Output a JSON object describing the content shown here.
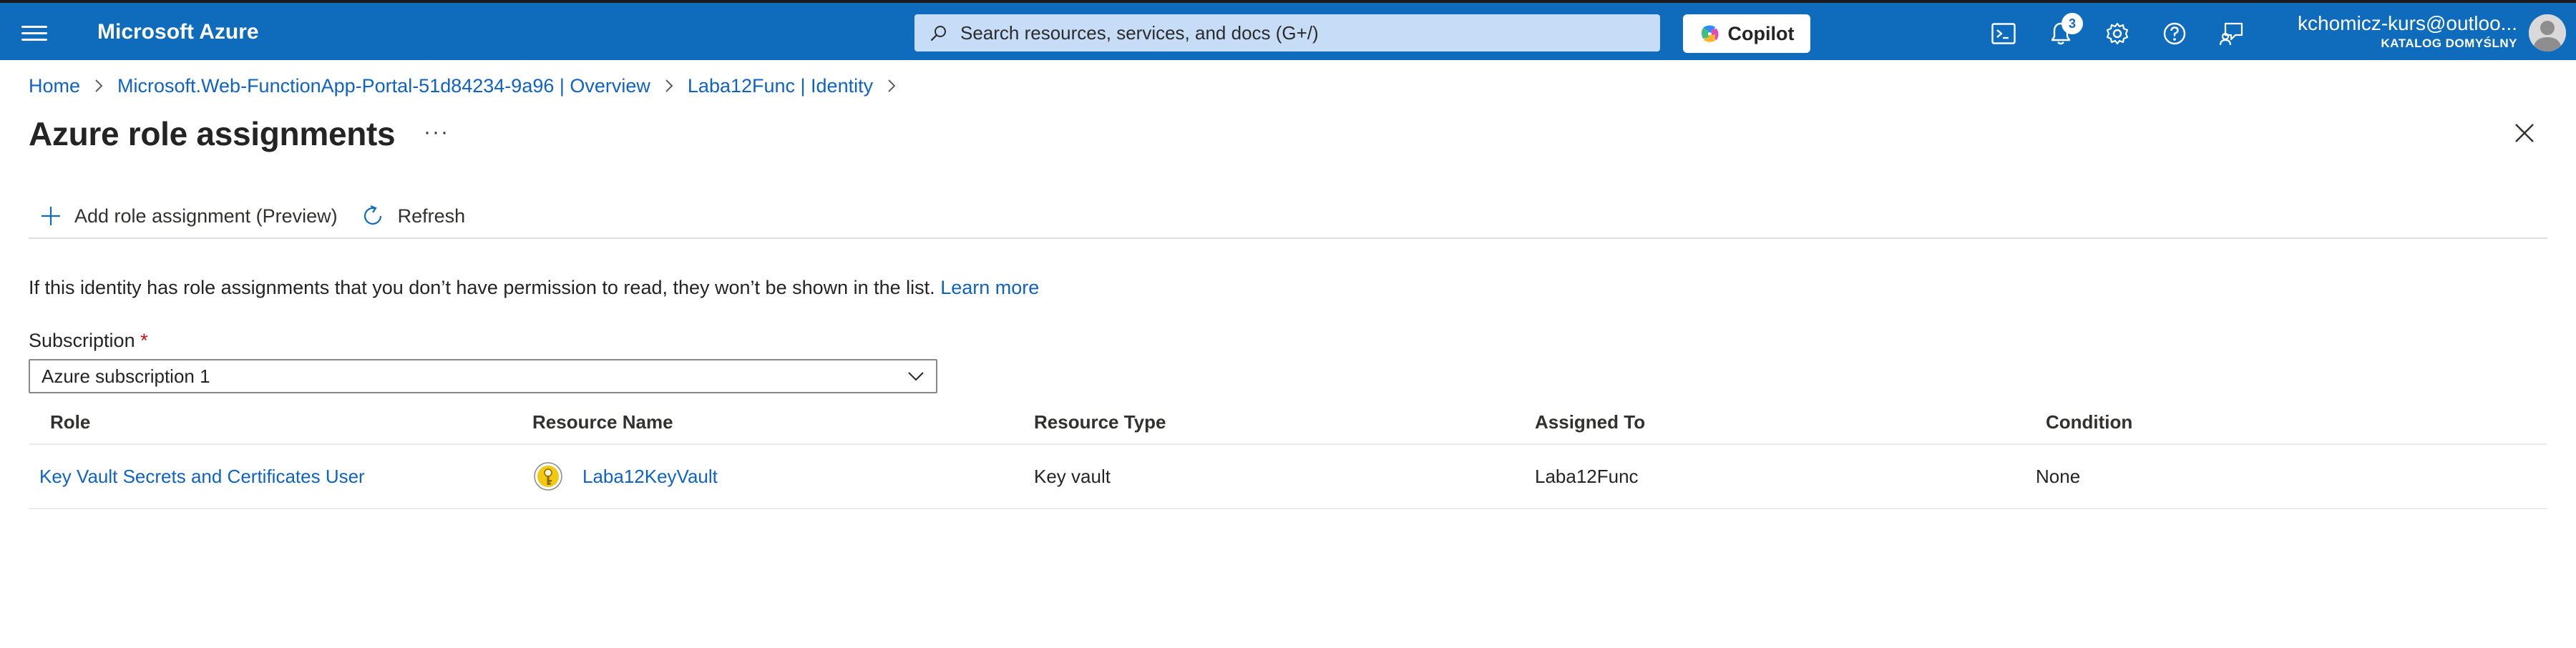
{
  "topbar": {
    "brand": "Microsoft Azure",
    "search_placeholder": "Search resources, services, and docs (G+/)",
    "copilot_label": "Copilot",
    "notifications_count": "3",
    "user": "kchomicz-kurs@outloo...",
    "tenant": "KATALOG DOMYŚLNY",
    "icons": [
      "cloud-shell-icon",
      "notifications-icon",
      "settings-icon",
      "help-icon",
      "feedback-icon"
    ],
    "accent": "#0f6cbd"
  },
  "breadcrumb": {
    "home": "Home",
    "app": "Microsoft.Web-FunctionApp-Portal-51d84234-9a96 | Overview",
    "identity": "Laba12Func | Identity"
  },
  "page": {
    "title": "Azure role assignments",
    "more": "···"
  },
  "toolbar": {
    "add_label": "Add role assignment (Preview)",
    "refresh_label": "Refresh"
  },
  "info": {
    "text": "If this identity has role assignments that you don’t have permission to read, they won’t be shown in the list.",
    "link": "Learn more"
  },
  "subscription": {
    "label": "Subscription",
    "required_mark": "*",
    "value": "Azure subscription 1"
  },
  "table": {
    "headers": {
      "role": "Role",
      "resource_name": "Resource Name",
      "resource_type": "Resource Type",
      "assigned_to": "Assigned To",
      "condition": "Condition"
    },
    "rows": [
      {
        "role": "Key Vault Secrets and Certificates User",
        "resource_name": "Laba12KeyVault",
        "resource_type": "Key vault",
        "assigned_to": "Laba12Func",
        "condition": "None"
      }
    ]
  }
}
